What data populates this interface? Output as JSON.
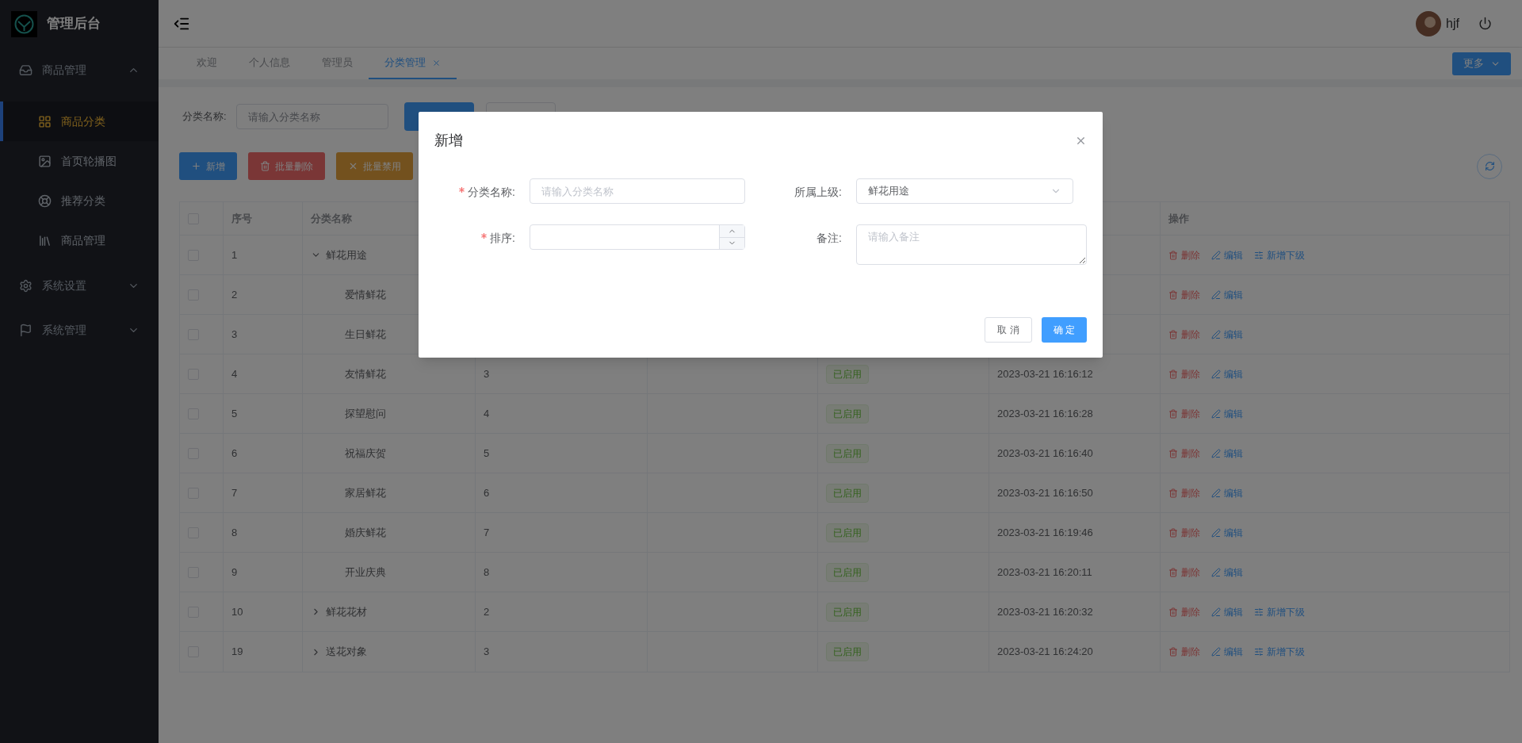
{
  "sidebar": {
    "title": "管理后台",
    "menu": [
      {
        "label": "商品管理",
        "expanded": true,
        "children": [
          {
            "label": "商品分类",
            "selected": true
          },
          {
            "label": "首页轮播图",
            "selected": false
          },
          {
            "label": "推荐分类",
            "selected": false
          },
          {
            "label": "商品管理",
            "selected": false
          }
        ]
      },
      {
        "label": "系统设置",
        "expanded": false
      },
      {
        "label": "系统管理",
        "expanded": false
      }
    ]
  },
  "header": {
    "user": "hjf"
  },
  "tabs": [
    {
      "label": "欢迎",
      "selected": false,
      "closable": false
    },
    {
      "label": "个人信息",
      "selected": false,
      "closable": false
    },
    {
      "label": "管理员",
      "selected": false,
      "closable": false
    },
    {
      "label": "分类管理",
      "selected": true,
      "closable": true
    }
  ],
  "more_button": "更多",
  "filter": {
    "label": "分类名称:",
    "placeholder": "请输入分类名称"
  },
  "toolbar": [
    {
      "label": "新增",
      "kind": "add"
    },
    {
      "label": "批量删除",
      "kind": "delete"
    },
    {
      "label": "批量禁用",
      "kind": "disable"
    }
  ],
  "table": {
    "all_checked": false,
    "columns": [
      {
        "label": "序号"
      },
      {
        "label": "分类名称"
      },
      {
        "label": "操作"
      }
    ],
    "rows": [
      {
        "checked": false,
        "index": "1",
        "name": "鲜花用途",
        "expanded": true,
        "actions": [
          {
            "label": "删除",
            "kind": "delete"
          },
          {
            "label": "编辑",
            "kind": "edit"
          },
          {
            "label": "新增下级",
            "kind": "add_child"
          }
        ],
        "children": [
          {
            "checked": false,
            "index": "2",
            "name": "爱情鲜花",
            "actions": [
              {
                "label": "删除",
                "kind": "delete"
              },
              {
                "label": "编辑",
                "kind": "edit"
              }
            ]
          },
          {
            "checked": false,
            "index": "3",
            "name": "生日鲜花",
            "actions": [
              {
                "label": "删除",
                "kind": "delete"
              },
              {
                "label": "编辑",
                "kind": "edit"
              }
            ]
          },
          {
            "checked": false,
            "index": "4",
            "name": "友情鲜花",
            "sort": "3",
            "status": "已启用",
            "created": "2023-03-21 16:16:12",
            "actions": [
              {
                "label": "删除",
                "kind": "delete"
              },
              {
                "label": "编辑",
                "kind": "edit"
              }
            ]
          },
          {
            "checked": false,
            "index": "5",
            "name": "探望慰问",
            "sort": "4",
            "status": "已启用",
            "created": "2023-03-21 16:16:28",
            "actions": [
              {
                "label": "删除",
                "kind": "delete"
              },
              {
                "label": "编辑",
                "kind": "edit"
              }
            ]
          },
          {
            "checked": false,
            "index": "6",
            "name": "祝福庆贺",
            "sort": "5",
            "status": "已启用",
            "created": "2023-03-21 16:16:40",
            "actions": [
              {
                "label": "删除",
                "kind": "delete"
              },
              {
                "label": "编辑",
                "kind": "edit"
              }
            ]
          },
          {
            "checked": false,
            "index": "7",
            "name": "家居鲜花",
            "sort": "6",
            "status": "已启用",
            "created": "2023-03-21 16:16:50",
            "actions": [
              {
                "label": "删除",
                "kind": "delete"
              },
              {
                "label": "编辑",
                "kind": "edit"
              }
            ]
          },
          {
            "checked": false,
            "index": "8",
            "name": "婚庆鲜花",
            "sort": "7",
            "status": "已启用",
            "created": "2023-03-21 16:19:46",
            "actions": [
              {
                "label": "删除",
                "kind": "delete"
              },
              {
                "label": "编辑",
                "kind": "edit"
              }
            ]
          },
          {
            "checked": false,
            "index": "9",
            "name": "开业庆典",
            "sort": "8",
            "status": "已启用",
            "created": "2023-03-21 16:20:11",
            "actions": [
              {
                "label": "删除",
                "kind": "delete"
              },
              {
                "label": "编辑",
                "kind": "edit"
              }
            ]
          }
        ]
      },
      {
        "checked": false,
        "index": "10",
        "name": "鲜花花材",
        "expanded": false,
        "sort": "2",
        "status": "已启用",
        "created": "2023-03-21 16:20:32",
        "actions": [
          {
            "label": "删除",
            "kind": "delete"
          },
          {
            "label": "编辑",
            "kind": "edit"
          },
          {
            "label": "新增下级",
            "kind": "add_child"
          }
        ]
      },
      {
        "checked": false,
        "index": "19",
        "name": "送花对象",
        "expanded": false,
        "sort": "3",
        "status": "已启用",
        "created": "2023-03-21 16:24:20",
        "actions": [
          {
            "label": "删除",
            "kind": "delete"
          },
          {
            "label": "编辑",
            "kind": "edit"
          },
          {
            "label": "新增下级",
            "kind": "add_child"
          }
        ]
      }
    ]
  },
  "dialog": {
    "title": "新增",
    "fields": [
      {
        "label": "分类名称:",
        "required": true,
        "kind": "text",
        "placeholder": "请输入分类名称"
      },
      {
        "label": "所属上级:",
        "required": false,
        "kind": "select",
        "value": "鲜花用途"
      },
      {
        "label": "排序:",
        "required": true,
        "kind": "number"
      },
      {
        "label": "备注:",
        "required": false,
        "kind": "textarea",
        "placeholder": "请输入备注"
      }
    ],
    "buttons": [
      {
        "label": "取 消",
        "kind": "default"
      },
      {
        "label": "确 定",
        "kind": "primary"
      }
    ]
  }
}
